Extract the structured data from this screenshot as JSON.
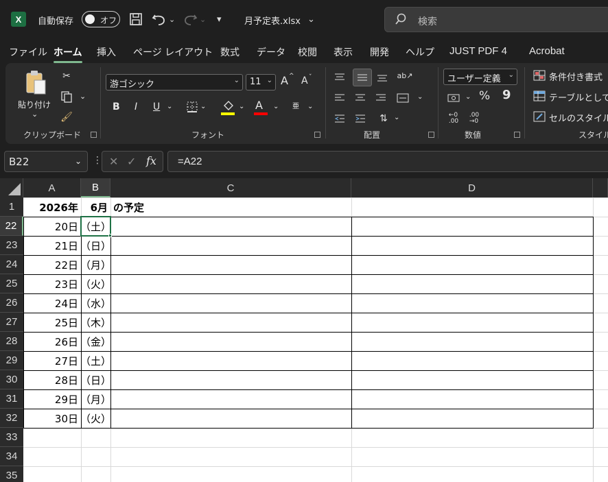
{
  "titlebar": {
    "autosave_label": "自動保存",
    "toggle_label": "オフ",
    "filename": "月予定表.xlsx",
    "search_placeholder": "検索"
  },
  "tabs": [
    "ファイル",
    "ホーム",
    "挿入",
    "ページ レイアウト",
    "数式",
    "データ",
    "校閲",
    "表示",
    "開発",
    "ヘルプ",
    "JUST PDF 4",
    "Acrobat"
  ],
  "active_tab": "ホーム",
  "ribbon": {
    "clipboard": {
      "paste_label": "貼り付け",
      "group_label": "クリップボード"
    },
    "font": {
      "font_name": "游ゴシック",
      "font_size": "11",
      "group_label": "フォント",
      "bold": "B",
      "italic": "I",
      "underline": "U",
      "phonetic": "亜",
      "font_color_glyph": "A",
      "grow": "A",
      "shrink": "A",
      "fill_color": "#ffff00",
      "font_color": "#ff0000"
    },
    "alignment": {
      "group_label": "配置"
    },
    "number": {
      "format": "ユーザー定義",
      "percent": "%",
      "comma": "9",
      "group_label": "数値"
    },
    "styles": {
      "conditional": "条件付き書式",
      "table": "テーブルとして書",
      "cell_style": "セルのスタイル",
      "group_label": "スタイル"
    }
  },
  "formula_bar": {
    "name_box": "B22",
    "fx": "fx",
    "formula": "=A22"
  },
  "columns": [
    "A",
    "B",
    "C",
    "D"
  ],
  "selected_column": "B",
  "header_row": {
    "row": "1",
    "a": "2026年",
    "b": "6月",
    "c": "の予定"
  },
  "rows": [
    {
      "row": "22",
      "day": "20日",
      "weekday": "（土）"
    },
    {
      "row": "23",
      "day": "21日",
      "weekday": "（日）"
    },
    {
      "row": "24",
      "day": "22日",
      "weekday": "（月）"
    },
    {
      "row": "25",
      "day": "23日",
      "weekday": "（火）"
    },
    {
      "row": "26",
      "day": "24日",
      "weekday": "（水）"
    },
    {
      "row": "27",
      "day": "25日",
      "weekday": "（木）"
    },
    {
      "row": "28",
      "day": "26日",
      "weekday": "（金）"
    },
    {
      "row": "29",
      "day": "27日",
      "weekday": "（土）"
    },
    {
      "row": "30",
      "day": "28日",
      "weekday": "（日）"
    },
    {
      "row": "31",
      "day": "29日",
      "weekday": "（月）"
    },
    {
      "row": "32",
      "day": "30日",
      "weekday": "（火）"
    }
  ],
  "empty_rows": [
    "33",
    "34",
    "35"
  ],
  "selected_row": "22",
  "accent_color": "#1e7145"
}
